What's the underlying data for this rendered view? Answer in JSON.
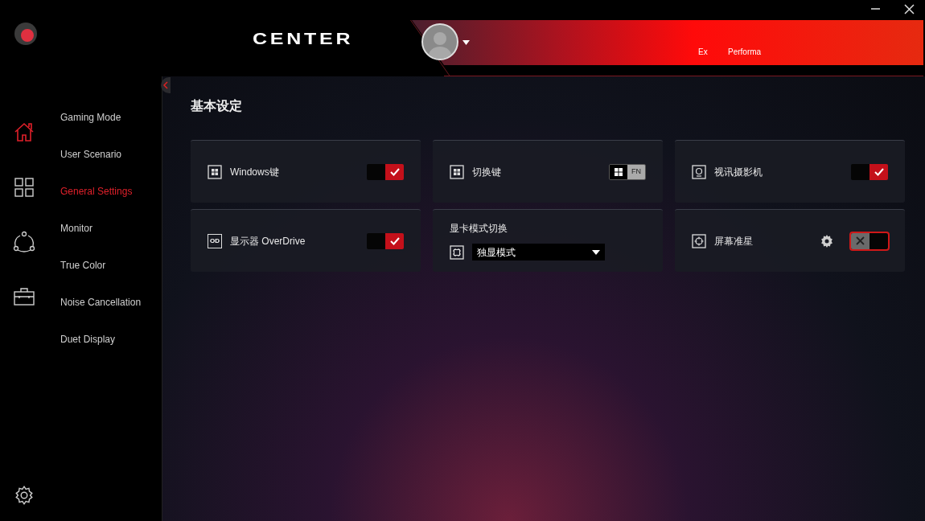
{
  "header": {
    "logo_text": "CENTER",
    "status_labels": [
      "Ex",
      "Performa"
    ]
  },
  "rail": [
    {
      "selected": true
    },
    {
      "selected": false
    },
    {
      "selected": false
    },
    {
      "selected": false
    }
  ],
  "menu": [
    {
      "label": "Gaming Mode",
      "selected": false
    },
    {
      "label": "User Scenario",
      "selected": false
    },
    {
      "label": "General Settings",
      "selected": true
    },
    {
      "label": "Monitor",
      "selected": false
    },
    {
      "label": "True Color",
      "selected": false
    },
    {
      "label": "Noise Cancellation",
      "selected": false
    },
    {
      "label": "Duet Display",
      "selected": false
    }
  ],
  "section_title": "基本设定",
  "cards": [
    {
      "kind": "toggle",
      "label": "Windows键",
      "on": true
    },
    {
      "kind": "fn_switch",
      "label": "切换键",
      "fn_label": "FN",
      "fn_selected": true
    },
    {
      "kind": "toggle",
      "label": "视讯摄影机",
      "on": true
    },
    {
      "kind": "toggle",
      "icon_text": "OD",
      "label": "显示器 OverDrive",
      "on": true
    },
    {
      "kind": "dropdown",
      "label": "显卡模式切换",
      "value": "独显模式"
    },
    {
      "kind": "toggle_gear",
      "label": "屏幕准星",
      "on": false
    }
  ]
}
